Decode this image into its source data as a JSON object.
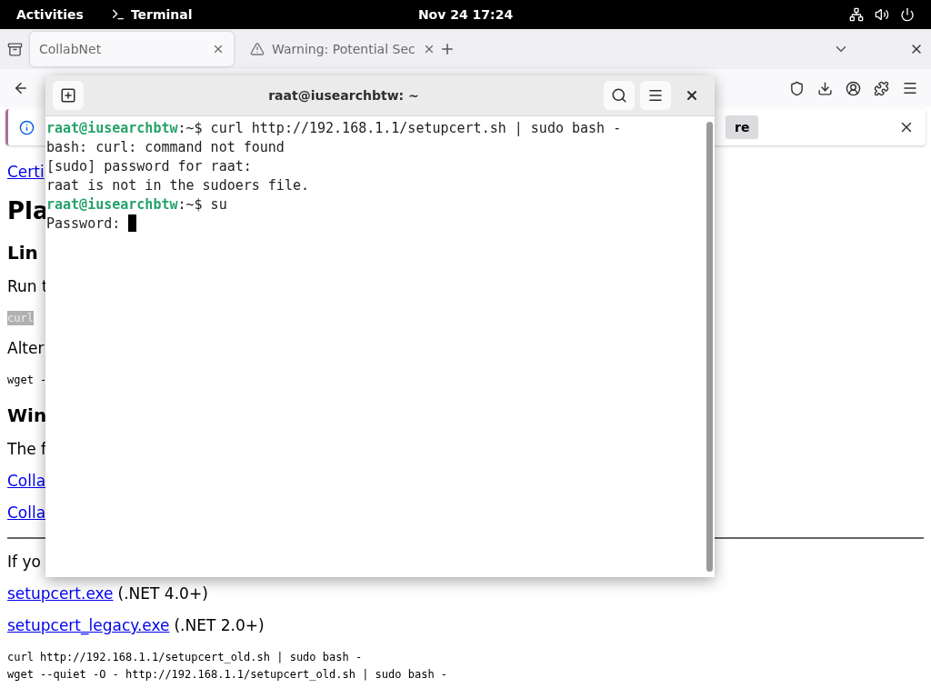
{
  "top_bar": {
    "activities": "Activities",
    "app": "Terminal",
    "clock": "Nov 24  17:24"
  },
  "browser": {
    "tabs": [
      {
        "title": "CollabNet",
        "kind": "page",
        "selected": true
      },
      {
        "title": "Warning: Potential Sec",
        "kind": "warning",
        "selected": false
      }
    ],
    "info_bar": {
      "button": "re"
    },
    "page": [
      {
        "kind": "link",
        "text": "Certi"
      },
      {
        "kind": "h1",
        "text": "Pla"
      },
      {
        "kind": "h3",
        "text": "Lin"
      },
      {
        "kind": "p",
        "text": "Run t"
      },
      {
        "kind": "code_hl",
        "text": "curl"
      },
      {
        "kind": "p",
        "text": "Alter"
      },
      {
        "kind": "code",
        "text": "wget -"
      },
      {
        "kind": "h3",
        "text": "Win"
      },
      {
        "kind": "p",
        "text": "The f"
      },
      {
        "kind": "link",
        "text": "Colla"
      },
      {
        "kind": "link",
        "text": "Colla"
      },
      {
        "kind": "hr"
      },
      {
        "kind": "p",
        "text": "If yo"
      },
      {
        "kind": "link_note",
        "text": "setupcert.exe",
        "note": "(.NET 4.0+)"
      },
      {
        "kind": "link_note",
        "text": "setupcert_legacy.exe",
        "note": "(.NET 2.0+)"
      },
      {
        "kind": "code_block",
        "lines": [
          "curl http://192.168.1.1/setupcert_old.sh | sudo bash -",
          "wget --quiet -O - http://192.168.1.1/setupcert_old.sh | sudo bash -"
        ]
      }
    ]
  },
  "terminal": {
    "title": "raat@iusearchbtw: ~",
    "lines": [
      {
        "kind": "prompt",
        "user": "raat@iusearchbtw",
        "text": ":~$ curl http://192.168.1.1/setupcert.sh | sudo bash -",
        "cursor": false
      },
      {
        "kind": "output",
        "text": "bash: curl: command not found",
        "cursor": false
      },
      {
        "kind": "output",
        "text": "[sudo] password for raat:",
        "cursor": false
      },
      {
        "kind": "output",
        "text": "raat is not in the sudoers file.",
        "cursor": false
      },
      {
        "kind": "prompt",
        "user": "raat@iusearchbtw",
        "text": ":~$ su",
        "cursor": false
      },
      {
        "kind": "output",
        "text": "Password: ",
        "cursor": true
      }
    ]
  }
}
